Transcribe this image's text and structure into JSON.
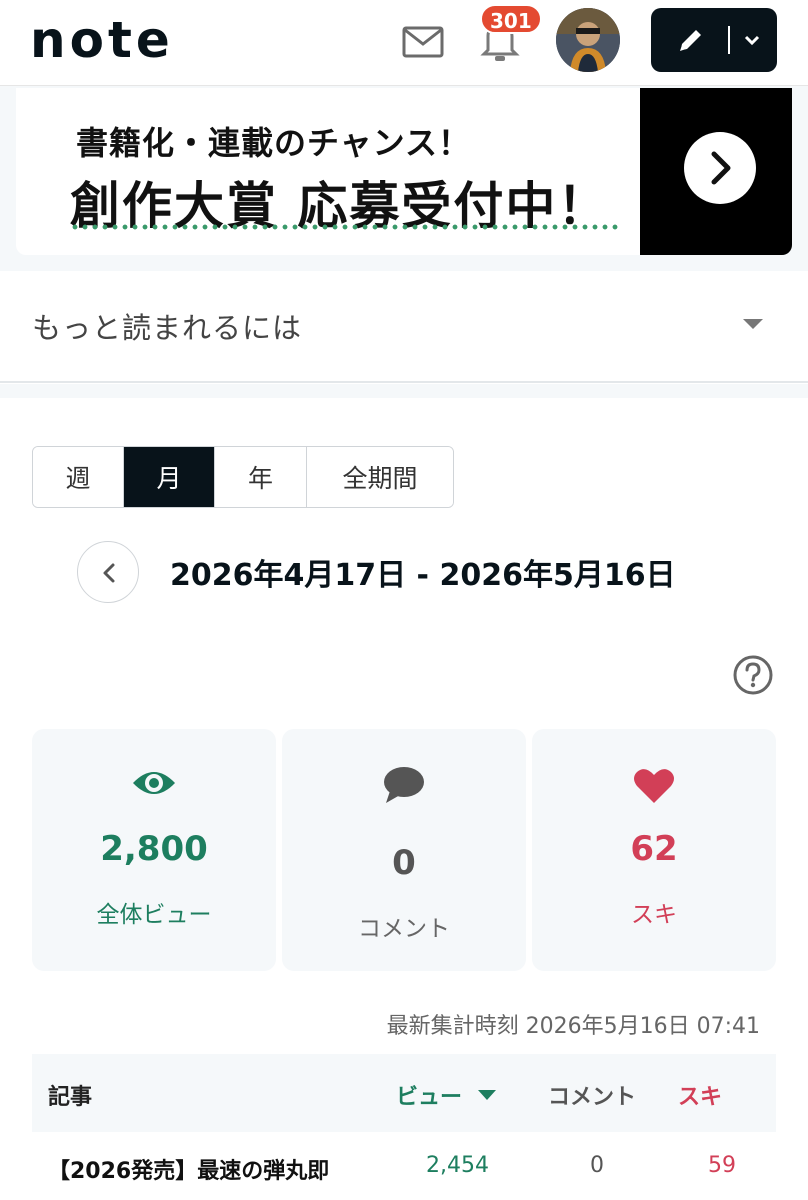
{
  "header": {
    "logo": "note",
    "notification_count": "301"
  },
  "banner": {
    "line1": "書籍化・連載のチャンス！",
    "line2": "創作大賞 応募受付中！"
  },
  "accordion": {
    "label": "もっと読まれるには"
  },
  "period_tabs": [
    {
      "label": "週",
      "active": false
    },
    {
      "label": "月",
      "active": true
    },
    {
      "label": "年",
      "active": false
    },
    {
      "label": "全期間",
      "active": false
    }
  ],
  "date_range": "2026年4月17日 - 2026年5月16日",
  "stats": {
    "views": {
      "value": "2,800",
      "label": "全体ビュー",
      "color": "#1d7e5f"
    },
    "comments": {
      "value": "0",
      "label": "コメント",
      "color": "#555555"
    },
    "likes": {
      "value": "62",
      "label": "スキ",
      "color": "#d23f57"
    }
  },
  "updated_at": "最新集計時刻 2026年5月16日 07:41",
  "table": {
    "headers": {
      "article": "記事",
      "views": "ビュー",
      "comments": "コメント",
      "likes": "スキ"
    },
    "rows": [
      {
        "title": "【2026発売】最速の弾丸即",
        "views": "2,454",
        "comments": "0",
        "likes": "59"
      }
    ]
  },
  "colors": {
    "accent_dark": "#08131a",
    "view_green": "#1d7e5f",
    "like_red": "#d23f57",
    "badge_red": "#e44a31"
  }
}
